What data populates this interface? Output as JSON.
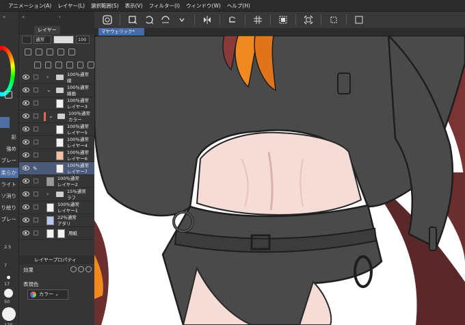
{
  "menu": [
    "アニメーション(A)",
    "レイヤー(L)",
    "選択範囲(S)",
    "表示(V)",
    "フィルター(I)",
    "ウィンドウ(W)",
    "ヘルプ(H)"
  ],
  "panel": {
    "layer_tab": "レイヤー",
    "blend_mode": "通常",
    "opacity": "100"
  },
  "layers": [
    {
      "l1": "100％通常",
      "l2": "線"
    },
    {
      "l1": "100％通常",
      "l2": "線画"
    },
    {
      "l1": "100％通常",
      "l2": "レイヤー3"
    },
    {
      "l1": "100％通常",
      "l2": "カラー"
    },
    {
      "l1": "100％通常",
      "l2": "レイヤー5"
    },
    {
      "l1": "100％通常",
      "l2": "レイヤー4"
    },
    {
      "l1": "100％通常",
      "l2": "レイヤー6"
    },
    {
      "l1": "100％通常",
      "l2": "レイヤー7"
    },
    {
      "l1": "100％通常",
      "l2": "レイヤー2"
    },
    {
      "l1": "15％通常",
      "l2": "ラフ"
    },
    {
      "l1": "100％通常",
      "l2": "レイヤー1"
    },
    {
      "l1": "22％通常",
      "l2": "アタリ"
    },
    {
      "l1": "",
      "l2": "用紙"
    }
  ],
  "tools": {
    "labels": [
      "彩",
      "強め",
      "ブレー",
      "柔らか",
      "ライト",
      "ソ消り",
      "り絵り",
      "ブレー"
    ],
    "sizes": [
      "2.5",
      "7",
      "17",
      "50",
      "170"
    ]
  },
  "layer_property": {
    "title": "レイヤープロパティ",
    "effect_label": "効果",
    "express_label": "表現色",
    "color_mode": "カラー"
  },
  "document": {
    "tab_title": "マヤウェリック*"
  },
  "colors": {
    "canvas_bg": "#ffffff",
    "jacket": "#4a4a4a",
    "skin": "#f6dcd6",
    "hair_orange": "#f08a20",
    "hair_dark": "#5a2a2a",
    "selected_layer": "#4b5a78",
    "doc_tab": "#476aa8"
  }
}
